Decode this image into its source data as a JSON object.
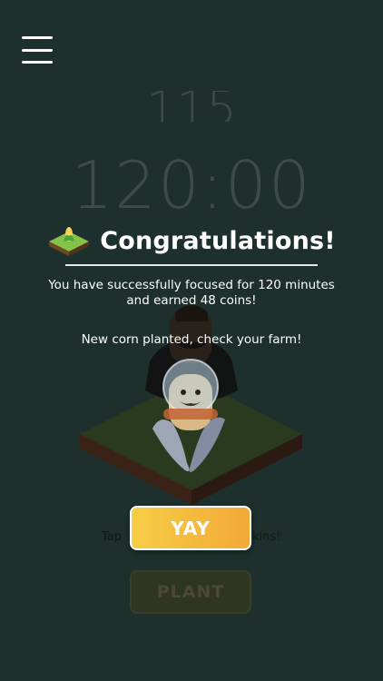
{
  "header": {
    "menu_icon": "hamburger-menu-icon"
  },
  "background": {
    "digits_partial": "115",
    "timer": "120:00"
  },
  "dialog": {
    "title": "Congratulations!",
    "title_icon": "grass-tile-corn-icon",
    "message_line1": "You have successfully focused for 120 minutes",
    "message_line2": "and earned 48 coins!",
    "planted_message": "New corn planted, check your farm!"
  },
  "hint": {
    "left": "Tap",
    "right": "kins!"
  },
  "buttons": {
    "yay_label": "YAY",
    "plant_label": "PLANT"
  },
  "colors": {
    "background": "#1d302d",
    "yay_gradient_start": "#f6cd45",
    "yay_gradient_end": "#f3a937",
    "tile_top": "#293a1f",
    "tile_side": "#3a2316"
  }
}
